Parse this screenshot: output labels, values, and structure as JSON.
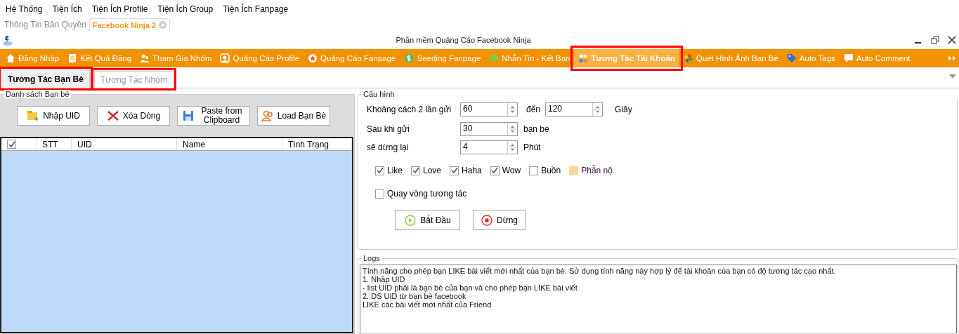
{
  "menu_bar": [
    "Hệ Thống",
    "Tiện Ích",
    "Tiện Ích Profile",
    "Tiện Ích Group",
    "Tiện Ích Fanpage"
  ],
  "document_tabs": [
    {
      "label": "Thông Tin Bản Quyền",
      "selected": false,
      "closable": false
    },
    {
      "label": "Facebook Ninja 2",
      "selected": true,
      "closable": true
    }
  ],
  "window": {
    "title": "Phần mềm Quảng Cáo Facebook Ninja"
  },
  "toolbar": [
    {
      "label": "Đăng Nhập",
      "selected": false,
      "highlighted": false
    },
    {
      "label": "Kết Quả Đăng",
      "selected": false,
      "highlighted": false
    },
    {
      "label": "Tham Gia Nhóm",
      "selected": false,
      "highlighted": false
    },
    {
      "label": "Quảng Cáo Profile",
      "selected": false,
      "highlighted": false
    },
    {
      "label": "Quảng Cáo Fanpage",
      "selected": false,
      "highlighted": false
    },
    {
      "label": "Seeding Fanpage",
      "selected": false,
      "highlighted": false
    },
    {
      "label": "Nhắn Tin - Kết Bạn",
      "selected": false,
      "highlighted": false
    },
    {
      "label": "Tương Tác Tài Khoản",
      "selected": true,
      "highlighted": true
    },
    {
      "label": "Quét Hình Ảnh Bạn Bè",
      "selected": false,
      "highlighted": false
    },
    {
      "label": "Auto Tags",
      "selected": false,
      "highlighted": false
    },
    {
      "label": "Auto Comment",
      "selected": false,
      "highlighted": false
    }
  ],
  "sub_tabs": [
    {
      "label": "Tương Tác Bạn Bè",
      "selected": true,
      "highlighted": true
    },
    {
      "label": "Tương Tác Nhóm",
      "selected": false,
      "highlighted": true
    }
  ],
  "friends_panel": {
    "title": "Danh sách Bạn bè",
    "buttons": [
      "Nhập UID",
      "Xóa Dòng",
      "Paste from Clipboard",
      "Load Bạn Bè"
    ],
    "table": {
      "select_all_checked": true,
      "columns": [
        "STT",
        "UID",
        "Name",
        "Tình Trạng"
      ]
    }
  },
  "config": {
    "title": "Cấu hình",
    "rows": [
      {
        "label": "Khoảng cách 2 lần gửi",
        "value": "60",
        "between": "đến",
        "value_2": "120",
        "unit": "Giây"
      },
      {
        "label": "Sau khi gửi",
        "value": "30",
        "unit": "bạn bè"
      },
      {
        "label": "sẽ dừng lại",
        "value": "4",
        "unit": "Phút"
      }
    ],
    "reactions": [
      {
        "label": "Like",
        "checked": true,
        "hovered": false
      },
      {
        "label": "Love",
        "checked": true,
        "hovered": false
      },
      {
        "label": "Haha",
        "checked": true,
        "hovered": false
      },
      {
        "label": "Wow",
        "checked": true,
        "hovered": false
      },
      {
        "label": "Buồn",
        "checked": false,
        "hovered": false
      },
      {
        "label": "Phẫn nộ",
        "checked": false,
        "hovered": true
      }
    ],
    "loop": {
      "label": "Quay vòng tương tác",
      "checked": false
    },
    "start_button": "Bắt Đầu",
    "stop_button": "Dừng"
  },
  "logs": {
    "title": "Logs",
    "lines": [
      "Tính năng cho phép bạn LIKE bài viết mới nhất của bạn bè. Sử dụng tính năng này hợp lý để tài khoản của bạn có độ tương tác cao nhất.",
      "1. Nhập UID",
      "- list UID phải là bạn bè của bạn và cho phép bạn LIKE bài viết",
      "2. DS UID từ bạn bè facebook",
      "LIKE các bài viết mới nhất của Friend"
    ]
  }
}
